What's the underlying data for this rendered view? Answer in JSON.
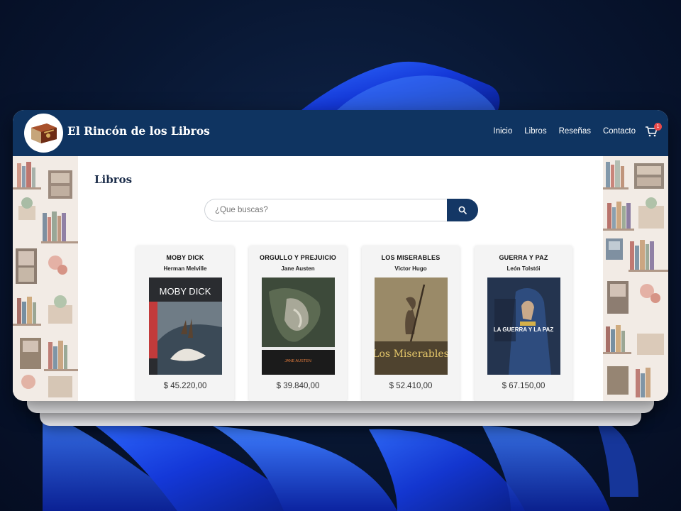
{
  "colors": {
    "navbar": "#0f3461",
    "accent": "#143765",
    "badge": "#e84a4a",
    "title": "#1d2e4b"
  },
  "header": {
    "brand": "El Rincón de los Libros",
    "logo_icon": "book-icon",
    "nav": [
      "Inicio",
      "Libros",
      "Reseñas",
      "Contacto"
    ],
    "cart_icon": "cart-icon",
    "cart_count": "1"
  },
  "main": {
    "title": "Libros",
    "search": {
      "placeholder": "¿Que buscas?",
      "button_icon": "search-icon"
    },
    "books": [
      {
        "title": "MOBY DICK",
        "author": "Herman Melville",
        "price": "$ 45.220,00",
        "cover_text": "MOBY DICK"
      },
      {
        "title": "ORGULLO Y PREJUICIO",
        "author": "Jane Austen",
        "price": "$ 39.840,00",
        "cover_text": "JANE AUSTEN"
      },
      {
        "title": "LOS MISERABLES",
        "author": "Victor Hugo",
        "price": "$ 52.410,00",
        "cover_text": "Los Miserables"
      },
      {
        "title": "GUERRA Y PAZ",
        "author": "León Tolstói",
        "price": "$ 67.150,00",
        "cover_text": "LA GUERRA Y LA PAZ"
      }
    ]
  }
}
